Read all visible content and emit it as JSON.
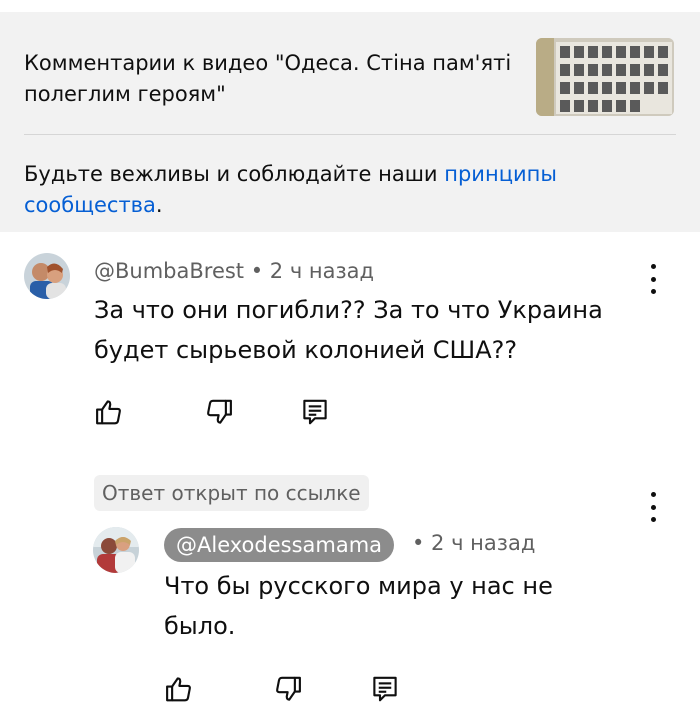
{
  "header": {
    "title": "Комментарии к видео \"Одеса. Стіна пам'яті полеглим героям\"",
    "guidelines_text": "Будьте вежливы и соблюдайте наши ",
    "guidelines_link": "принципы сообщества",
    "guidelines_end": "."
  },
  "comment": {
    "author": "@BumbaBrest",
    "separator": " • ",
    "time": "2 ч назад",
    "text": "За что они погибли?? За то что Украина будет сырьевой колонией США??",
    "actions": {
      "like_icon": "thumb-up-icon",
      "dislike_icon": "thumb-down-icon",
      "reply_icon": "reply-icon"
    }
  },
  "reply": {
    "badge": "Ответ открыт по ссылке",
    "author": "@Alexodessamama",
    "time": "• 2 ч назад",
    "text": "Что бы русского мира у нас не было.",
    "actions": {
      "like_icon": "thumb-up-icon",
      "dislike_icon": "thumb-down-icon",
      "reply_icon": "reply-icon"
    }
  },
  "colors": {
    "header_bg": "#f2f2f2",
    "link": "#065fd4",
    "meta": "#606060",
    "chip": "#8c8c8c"
  }
}
